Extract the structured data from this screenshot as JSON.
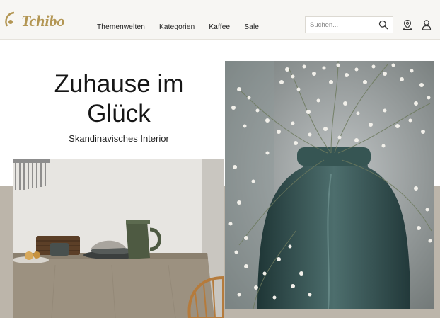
{
  "header": {
    "logo_text": "Tchibo",
    "nav": [
      "Themenwelten",
      "Kategorien",
      "Kaffee",
      "Sale"
    ],
    "search": {
      "placeholder": "Suchen..."
    },
    "icons": [
      "search-icon",
      "store-locator-icon",
      "account-icon"
    ]
  },
  "hero": {
    "title_line1": "Zuhause im",
    "title_line2": "Glück",
    "subtitle": "Skandinavisches Interior"
  },
  "colors": {
    "logo_gold": "#b39653",
    "header_bg": "#f7f6f3",
    "band": "#bcb5aa"
  }
}
